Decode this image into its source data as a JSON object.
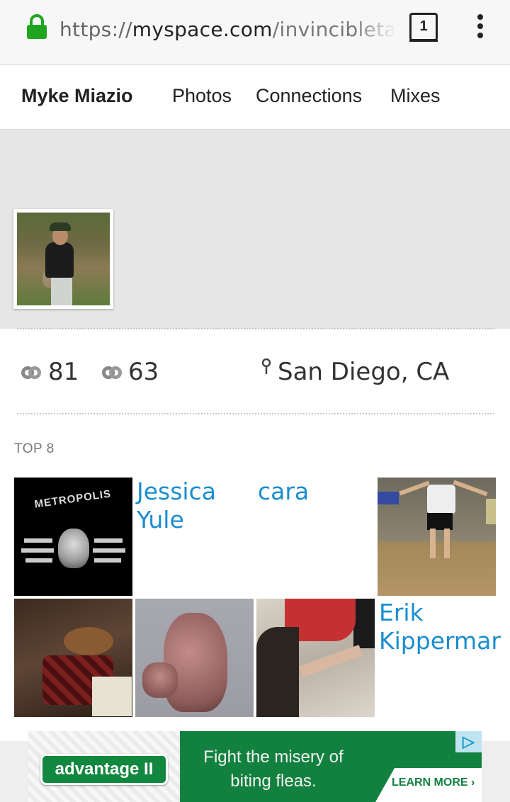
{
  "browser": {
    "url_scheme": "https://",
    "url_host": "myspace.com",
    "url_path": "/invincibletatto",
    "tab_count": "1",
    "icons": {
      "lock": "lock-icon",
      "menu": "overflow-menu-icon"
    },
    "lock_color": "#1fa51f"
  },
  "nav": {
    "profile_name": "Myke Miazio",
    "links": [
      "Photos",
      "Connections",
      "Mixes"
    ]
  },
  "stats": {
    "connections_in": "81",
    "connections_out": "63",
    "location": "San Diego, CA"
  },
  "top8": {
    "title": "TOP 8",
    "name_color": "#1a8dcf",
    "friends": [
      {
        "type": "image",
        "alt": "Metropolis",
        "label_in_image": "METROPOLIS"
      },
      {
        "type": "text",
        "name": "Jessica Yule"
      },
      {
        "type": "text",
        "name": "cara"
      },
      {
        "type": "image"
      },
      {
        "type": "image"
      },
      {
        "type": "image"
      },
      {
        "type": "image"
      },
      {
        "type": "text",
        "name": "Erik Kippermar"
      }
    ]
  },
  "ad": {
    "brand": "advantage II",
    "headline": "Fight the misery of biting fleas.",
    "cta": "LEARN MORE ›",
    "adchoice": "▷",
    "brand_color": "#12813f"
  }
}
